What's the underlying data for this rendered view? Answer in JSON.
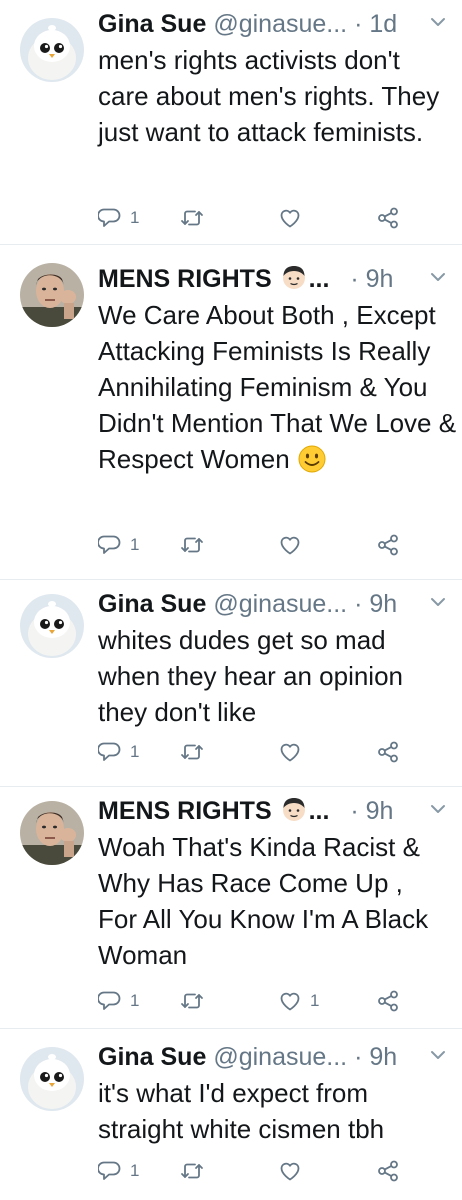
{
  "tweets": [
    {
      "author": "Gina Sue",
      "handle": "@ginasue...",
      "sep": "·",
      "time": "1d",
      "text": "men's rights activists don't care about men's rights. They just want to attack feminists.",
      "reply_count": "1",
      "retweet_count": "",
      "like_count": ""
    },
    {
      "author": "MENS RIGHTS",
      "handle": "...",
      "sep": "·",
      "time": "9h",
      "text": "We Care About Both , Except Attacking Feminists Is Really Annihilating Feminism & You Didn't Mention That We Love & Respect Women",
      "reply_count": "1",
      "retweet_count": "",
      "like_count": ""
    },
    {
      "author": "Gina Sue",
      "handle": "@ginasue...",
      "sep": "·",
      "time": "9h",
      "text": "whites dudes get so mad when they hear an opinion they don't like",
      "reply_count": "1",
      "retweet_count": "",
      "like_count": ""
    },
    {
      "author": "MENS RIGHTS",
      "handle": "...",
      "sep": "·",
      "time": "9h",
      "text": "Woah That's Kinda Racist & Why Has Race Come Up , For All You Know I'm A Black Woman",
      "reply_count": "1",
      "retweet_count": "",
      "like_count": "1"
    },
    {
      "author": "Gina Sue",
      "handle": "@ginasue...",
      "sep": "·",
      "time": "9h",
      "text": "it's what I'd expect from straight white cismen tbh",
      "reply_count": "1",
      "retweet_count": "",
      "like_count": ""
    }
  ],
  "icons": {
    "reply": "reply-icon",
    "retweet": "retweet-icon",
    "like": "heart-icon",
    "share": "share-icon",
    "caret": "chevron-down-icon",
    "man_emoji": "man-emoji-icon",
    "smile_emoji": "smiling-face-emoji-icon"
  },
  "colors": {
    "icon_gray": "#657786",
    "text": "#14171a",
    "divider": "#e6ecf0"
  }
}
